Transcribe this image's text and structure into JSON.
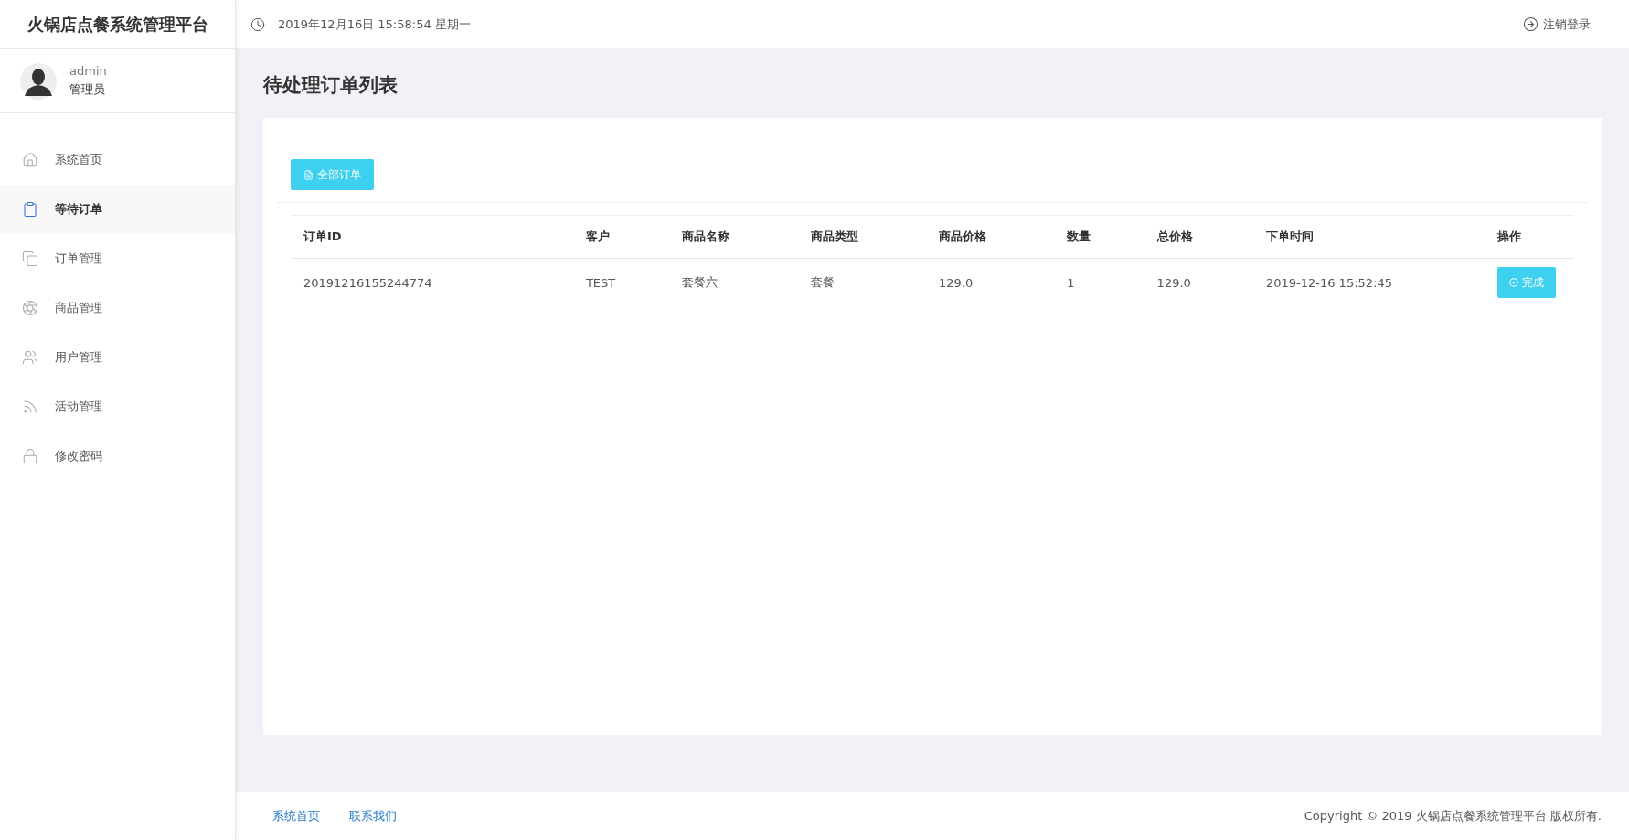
{
  "app_title": "火锅店点餐系统管理平台",
  "user": {
    "name": "admin",
    "role": "管理员"
  },
  "sidebar": {
    "items": [
      {
        "kind": "home",
        "label": "系统首页",
        "selected": false
      },
      {
        "kind": "clipboard",
        "label": "等待订单",
        "selected": true
      },
      {
        "kind": "copy",
        "label": "订单管理",
        "selected": false
      },
      {
        "kind": "aperture",
        "label": "商品管理",
        "selected": false
      },
      {
        "kind": "users",
        "label": "用户管理",
        "selected": false
      },
      {
        "kind": "rss",
        "label": "活动管理",
        "selected": false
      },
      {
        "kind": "lock",
        "label": "修改密码",
        "selected": false
      }
    ]
  },
  "header": {
    "datetime": "2019年12月16日 15:58:54 星期一",
    "logout": "注销登录"
  },
  "page_title": "待处理订单列表",
  "all_orders_button": "全部订单",
  "table": {
    "columns": [
      "订单ID",
      "客户",
      "商品名称",
      "商品类型",
      "商品价格",
      "数量",
      "总价格",
      "下单时间",
      "操作"
    ],
    "rows": [
      {
        "cells": [
          "20191216155244774",
          "TEST",
          "套餐六",
          "套餐",
          "129.0",
          "1",
          "129.0",
          "2019-12-16 15:52:45"
        ],
        "action": "完成"
      }
    ]
  },
  "footer": {
    "links": [
      "系统首页",
      "联系我们"
    ],
    "copyright": "Copyright © 2019 火锅店点餐系统管理平台 版权所有."
  }
}
